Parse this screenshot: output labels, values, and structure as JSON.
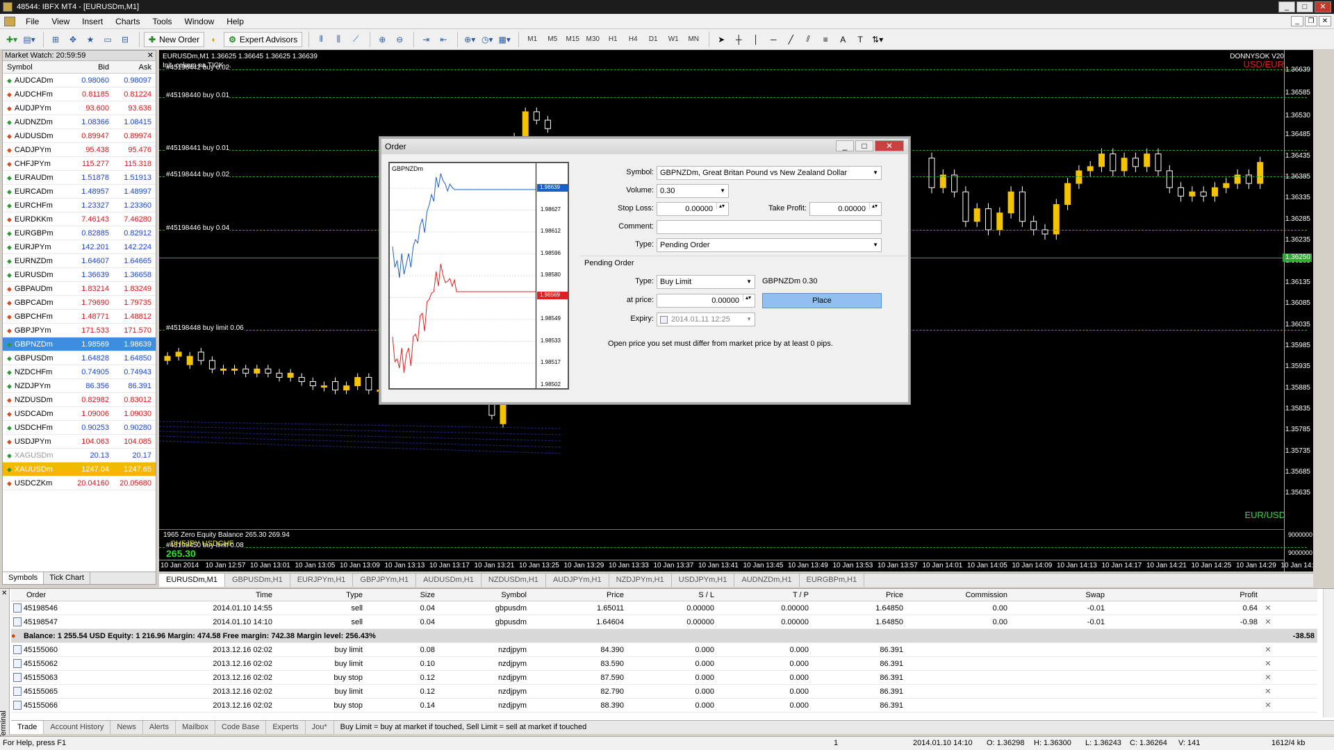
{
  "window": {
    "title": "48544: IBFX MT4 - [EURUSDm,M1]"
  },
  "menu": [
    "File",
    "View",
    "Insert",
    "Charts",
    "Tools",
    "Window",
    "Help"
  ],
  "toolbar": {
    "new_order": "New Order",
    "expert_advisors": "Expert Advisors",
    "timeframes": [
      "M1",
      "M5",
      "M15",
      "M30",
      "H1",
      "H4",
      "D1",
      "W1",
      "MN"
    ]
  },
  "market_watch": {
    "title": "Market Watch: 20:59:59",
    "columns": {
      "symbol": "Symbol",
      "bid": "Bid",
      "ask": "Ask"
    },
    "rows": [
      {
        "symbol": "AUDCADm",
        "bid": "0.98060",
        "ask": "0.98097",
        "dir": "up"
      },
      {
        "symbol": "AUDCHFm",
        "bid": "0.81185",
        "ask": "0.81224",
        "dir": "dn"
      },
      {
        "symbol": "AUDJPYm",
        "bid": "93.600",
        "ask": "93.636",
        "dir": "dn"
      },
      {
        "symbol": "AUDNZDm",
        "bid": "1.08366",
        "ask": "1.08415",
        "dir": "up"
      },
      {
        "symbol": "AUDUSDm",
        "bid": "0.89947",
        "ask": "0.89974",
        "dir": "dn"
      },
      {
        "symbol": "CADJPYm",
        "bid": "95.438",
        "ask": "95.476",
        "dir": "dn"
      },
      {
        "symbol": "CHFJPYm",
        "bid": "115.277",
        "ask": "115.318",
        "dir": "dn"
      },
      {
        "symbol": "EURAUDm",
        "bid": "1.51878",
        "ask": "1.51913",
        "dir": "up"
      },
      {
        "symbol": "EURCADm",
        "bid": "1.48957",
        "ask": "1.48997",
        "dir": "up"
      },
      {
        "symbol": "EURCHFm",
        "bid": "1.23327",
        "ask": "1.23360",
        "dir": "up"
      },
      {
        "symbol": "EURDKKm",
        "bid": "7.46143",
        "ask": "7.46280",
        "dir": "dn"
      },
      {
        "symbol": "EURGBPm",
        "bid": "0.82885",
        "ask": "0.82912",
        "dir": "up"
      },
      {
        "symbol": "EURJPYm",
        "bid": "142.201",
        "ask": "142.224",
        "dir": "up"
      },
      {
        "symbol": "EURNZDm",
        "bid": "1.64607",
        "ask": "1.64665",
        "dir": "up"
      },
      {
        "symbol": "EURUSDm",
        "bid": "1.36639",
        "ask": "1.36658",
        "dir": "up"
      },
      {
        "symbol": "GBPAUDm",
        "bid": "1.83214",
        "ask": "1.83249",
        "dir": "dn"
      },
      {
        "symbol": "GBPCADm",
        "bid": "1.79690",
        "ask": "1.79735",
        "dir": "dn"
      },
      {
        "symbol": "GBPCHFm",
        "bid": "1.48771",
        "ask": "1.48812",
        "dir": "dn"
      },
      {
        "symbol": "GBPJPYm",
        "bid": "171.533",
        "ask": "171.570",
        "dir": "dn"
      },
      {
        "symbol": "GBPNZDm",
        "bid": "1.98569",
        "ask": "1.98639",
        "dir": "up",
        "selected": true
      },
      {
        "symbol": "GBPUSDm",
        "bid": "1.64828",
        "ask": "1.64850",
        "dir": "up"
      },
      {
        "symbol": "NZDCHFm",
        "bid": "0.74905",
        "ask": "0.74943",
        "dir": "up"
      },
      {
        "symbol": "NZDJPYm",
        "bid": "86.356",
        "ask": "86.391",
        "dir": "up"
      },
      {
        "symbol": "NZDUSDm",
        "bid": "0.82982",
        "ask": "0.83012",
        "dir": "dn"
      },
      {
        "symbol": "USDCADm",
        "bid": "1.09006",
        "ask": "1.09030",
        "dir": "dn"
      },
      {
        "symbol": "USDCHFm",
        "bid": "0.90253",
        "ask": "0.90280",
        "dir": "up"
      },
      {
        "symbol": "USDJPYm",
        "bid": "104.063",
        "ask": "104.085",
        "dir": "dn"
      },
      {
        "symbol": "XAGUSDm",
        "bid": "20.13",
        "ask": "20.17",
        "dir": "up",
        "disabled": true
      },
      {
        "symbol": "XAUUSDm",
        "bid": "1247.04",
        "ask": "1247.65",
        "dir": "up",
        "highlight": true
      },
      {
        "symbol": "USDCZKm",
        "bid": "20.04160",
        "ask": "20.05680",
        "dir": "dn"
      }
    ],
    "tabs": [
      "Symbols",
      "Tick Chart"
    ]
  },
  "chart": {
    "header": "EURUSDm,M1  1.36625 1.36645 1.36625 1.36639",
    "status": "Init, cekam na TICK ...",
    "indicator_name": "DONNYSOK V20",
    "pair_top": "USD/EUR",
    "pair_bottom": "EUR/USD",
    "order_lines": [
      {
        "label": "#45198442 buy 0.02",
        "price": 1.3664
      },
      {
        "label": "#45198440 buy 0.01",
        "price": 1.36575
      },
      {
        "label": "#45198441 buy 0.01",
        "price": 1.3645
      },
      {
        "label": "#45198444 buy 0.02",
        "price": 1.36387
      },
      {
        "label": "#45198446 buy 0.04",
        "price": 1.3626
      },
      {
        "label": "#45198448 buy limit 0.06",
        "price": 1.36022
      },
      {
        "label": "#45198450 buy limit 0.08",
        "price": 1.35508
      }
    ],
    "current_price": "1.36250",
    "price_ticks": [
      "1.36639",
      "1.36585",
      "1.36530",
      "1.36485",
      "1.36435",
      "1.36385",
      "1.36335",
      "1.36285",
      "1.36235",
      "1.36185",
      "1.36135",
      "1.36085",
      "1.36035",
      "1.35985",
      "1.35935",
      "1.35885",
      "1.35835",
      "1.35785",
      "1.35735",
      "1.35685",
      "1.35635"
    ],
    "time_ticks": [
      "10 Jan 2014",
      "10 Jan 12:57",
      "10 Jan 13:01",
      "10 Jan 13:05",
      "10 Jan 13:09",
      "10 Jan 13:13",
      "10 Jan 13:17",
      "10 Jan 13:21",
      "10 Jan 13:25",
      "10 Jan 13:29",
      "10 Jan 13:33",
      "10 Jan 13:37",
      "10 Jan 13:41",
      "10 Jan 13:45",
      "10 Jan 13:49",
      "10 Jan 13:53",
      "10 Jan 13:57",
      "10 Jan 14:01",
      "10 Jan 14:05",
      "10 Jan 14:09",
      "10 Jan 14:13",
      "10 Jan 14:17",
      "10 Jan 14:21",
      "10 Jan 14:25",
      "10 Jan 14:29",
      "10 Jan 14:33"
    ],
    "sub_window": {
      "line1": "1965 Zero Equity Balance 265.30 269.94",
      "line2": "CHFJPY  USDCHF",
      "line3": "265.30",
      "right_ticks": [
        "9000000",
        "9000000"
      ]
    },
    "tabs": [
      "EURUSDm,M1",
      "GBPUSDm,H1",
      "EURJPYm,H1",
      "GBPJPYm,H1",
      "AUDUSDm,H1",
      "NZDUSDm,H1",
      "AUDJPYm,H1",
      "NZDJPYm,H1",
      "USDJPYm,H1",
      "AUDNZDm,H1",
      "EURGBPm,H1"
    ]
  },
  "order_dialog": {
    "title": "Order",
    "mini_chart": {
      "symbol": "GBPNZDm",
      "ticks": [
        "1.98643",
        "1.98627",
        "1.98612",
        "1.98596",
        "1.98580",
        "1.98564",
        "1.98549",
        "1.98533",
        "1.98517",
        "1.98502"
      ],
      "ask_tag": "1.98639",
      "bid_tag": "1.98569"
    },
    "labels": {
      "symbol": "Symbol:",
      "volume": "Volume:",
      "stop_loss": "Stop Loss:",
      "take_profit": "Take Profit:",
      "comment": "Comment:",
      "type": "Type:",
      "pending_order": "Pending Order",
      "pending_type": "Type:",
      "at_price": "at price:",
      "expiry": "Expiry:"
    },
    "values": {
      "symbol": "GBPNZDm, Great Britan Pound vs New Zealand Dollar",
      "volume": "0.30",
      "stop_loss": "0.00000",
      "take_profit": "0.00000",
      "comment": "",
      "type": "Pending Order",
      "pending_type": "Buy Limit",
      "pending_summary": "GBPNZDm 0.30",
      "at_price": "0.00000",
      "expiry": "2014.01.11 12:25"
    },
    "place_button": "Place",
    "note": "Open price you set must differ from market price by at least 0 pips."
  },
  "terminal": {
    "side_label": "Terminal",
    "columns": [
      "Order",
      "Time",
      "Type",
      "Size",
      "Symbol",
      "Price",
      "S / L",
      "T / P",
      "Price",
      "Commission",
      "Swap",
      "Profit"
    ],
    "open_orders": [
      {
        "order": "45198546",
        "time": "2014.01.10 14:55",
        "type": "sell",
        "size": "0.04",
        "symbol": "gbpusdm",
        "price": "1.65011",
        "sl": "0.00000",
        "tp": "0.00000",
        "cur": "1.64850",
        "commission": "0.00",
        "swap": "-0.01",
        "profit": "0.64"
      },
      {
        "order": "45198547",
        "time": "2014.01.10 14:10",
        "type": "sell",
        "size": "0.04",
        "symbol": "gbpusdm",
        "price": "1.64604",
        "sl": "0.00000",
        "tp": "0.00000",
        "cur": "1.64850",
        "commission": "0.00",
        "swap": "-0.01",
        "profit": "-0.98"
      }
    ],
    "balance_line": "Balance: 1 255.54 USD  Equity: 1 216.96  Margin: 474.58  Free margin: 742.38  Margin level: 256.43%",
    "balance_profit": "-38.58",
    "pending_orders": [
      {
        "order": "45155060",
        "time": "2013.12.16 02:02",
        "type": "buy limit",
        "size": "0.08",
        "symbol": "nzdjpym",
        "price": "84.390",
        "sl": "0.000",
        "tp": "0.000",
        "cur": "86.391"
      },
      {
        "order": "45155062",
        "time": "2013.12.16 02:02",
        "type": "buy limit",
        "size": "0.10",
        "symbol": "nzdjpym",
        "price": "83.590",
        "sl": "0.000",
        "tp": "0.000",
        "cur": "86.391"
      },
      {
        "order": "45155063",
        "time": "2013.12.16 02:02",
        "type": "buy stop",
        "size": "0.12",
        "symbol": "nzdjpym",
        "price": "87.590",
        "sl": "0.000",
        "tp": "0.000",
        "cur": "86.391"
      },
      {
        "order": "45155065",
        "time": "2013.12.16 02:02",
        "type": "buy limit",
        "size": "0.12",
        "symbol": "nzdjpym",
        "price": "82.790",
        "sl": "0.000",
        "tp": "0.000",
        "cur": "86.391"
      },
      {
        "order": "45155066",
        "time": "2013.12.16 02:02",
        "type": "buy stop",
        "size": "0.14",
        "symbol": "nzdjpym",
        "price": "88.390",
        "sl": "0.000",
        "tp": "0.000",
        "cur": "86.391"
      }
    ],
    "tabs": [
      "Trade",
      "Account History",
      "News",
      "Alerts",
      "Mailbox",
      "Code Base",
      "Experts",
      "Jou*"
    ],
    "tip": "Buy Limit = buy at market if touched, Sell Limit = sell at market if touched"
  },
  "status_bar": {
    "help": "For Help, press F1",
    "profile": "1",
    "datetime": "2014.01.10 14:10",
    "open": "O: 1.36298",
    "high": "H: 1.36300",
    "low": "L: 1.36243",
    "close": "C: 1.36264",
    "volume": "V: 141",
    "traffic": "1612/4 kb"
  },
  "colors": {
    "bull": "#f5c400",
    "bear": "#ffffff",
    "grid_line": "#2ea82e",
    "selected_row": "#3d8ee0",
    "ask_line": "#1a5fc8",
    "bid_line": "#e02020"
  }
}
